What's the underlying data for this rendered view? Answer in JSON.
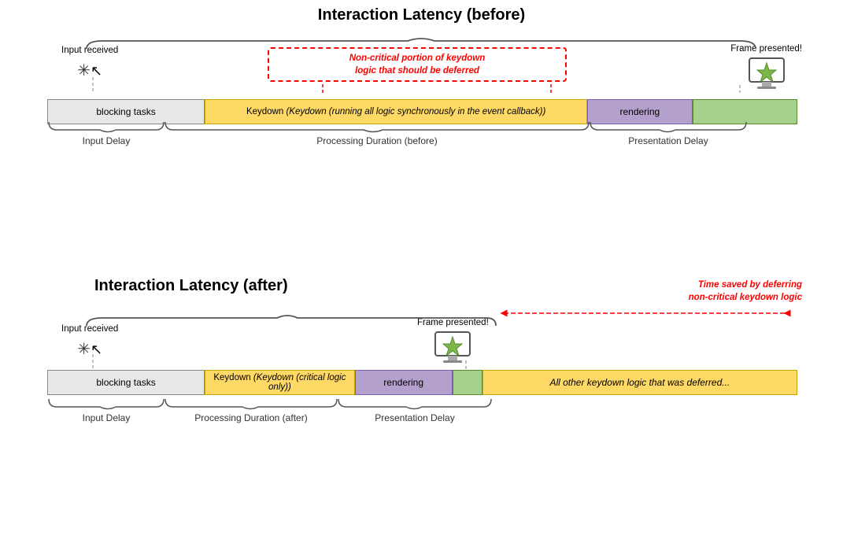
{
  "before": {
    "title": "Interaction Latency (before)",
    "input_received": "Input received",
    "frame_presented": "Frame presented!",
    "red_annotation": "Non-critical portion of keydown\nlogic that should be deferred",
    "bars": [
      {
        "id": "blocking",
        "label": "blocking tasks",
        "width_pct": 22
      },
      {
        "id": "keydown",
        "label": "Keydown (running all logic synchronously in the event callback)",
        "width_pct": 52
      },
      {
        "id": "rendering",
        "label": "rendering",
        "width_pct": 14
      },
      {
        "id": "green",
        "label": "",
        "width_pct": 12
      }
    ],
    "brace_labels": [
      {
        "label": "Input Delay",
        "center_pct": 11
      },
      {
        "label": "Processing Duration (before)",
        "center_pct": 48
      },
      {
        "label": "Presentation Delay",
        "center_pct": 83
      }
    ]
  },
  "after": {
    "title": "Interaction Latency (after)",
    "input_received": "Input received",
    "frame_presented": "Frame presented!",
    "time_saved_label": "Time saved by deferring\nnon-critical keydown logic",
    "bars": [
      {
        "id": "blocking",
        "label": "blocking tasks",
        "width_pct": 22
      },
      {
        "id": "keydown",
        "label": "Keydown (critical logic only)",
        "width_pct": 22
      },
      {
        "id": "rendering",
        "label": "rendering",
        "width_pct": 14
      },
      {
        "id": "green-small",
        "label": "",
        "width_pct": 4
      },
      {
        "id": "deferred",
        "label": "All other keydown logic that was deferred...",
        "width_pct": 38
      }
    ],
    "brace_labels": [
      {
        "label": "Input Delay",
        "center_pct": 11
      },
      {
        "label": "Processing Duration (after)",
        "center_pct": 33
      },
      {
        "label": "Presentation Delay",
        "center_pct": 55
      }
    ]
  }
}
